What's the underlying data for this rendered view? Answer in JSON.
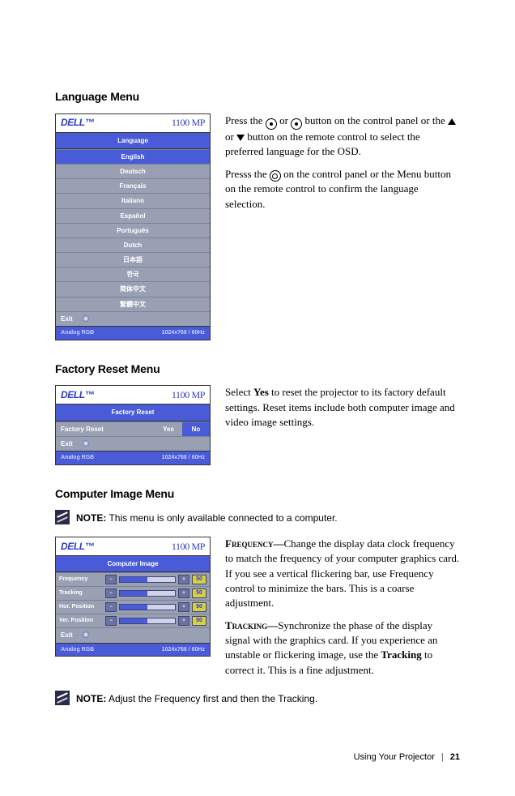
{
  "headings": {
    "language": "Language Menu",
    "factory": "Factory Reset Menu",
    "computer": "Computer Image Menu"
  },
  "osd": {
    "brand": "DELL™",
    "model": "1100 MP",
    "footer_left": "Analog RGB",
    "footer_right": "1024x768 / 60Hz",
    "exit": "Exit"
  },
  "language_menu": {
    "header": "Language",
    "items": [
      "English",
      "Deutsch",
      "Français",
      "Italiano",
      "Español",
      "Português",
      "Dutch",
      "日本語",
      "한국",
      "简体中文",
      "繁體中文"
    ]
  },
  "factory_menu": {
    "header": "Factory Reset",
    "label": "Factory Reset",
    "yes": "Yes",
    "no": "No"
  },
  "computer_menu": {
    "header": "Computer Image",
    "rows": [
      {
        "label": "Frequency",
        "val": "50"
      },
      {
        "label": "Tracking",
        "val": "50"
      },
      {
        "label": "Hor. Position",
        "val": "50"
      },
      {
        "label": "Ver. Position",
        "val": "50"
      }
    ]
  },
  "text": {
    "lang_p1a": "Press the ",
    "lang_p1b": " or ",
    "lang_p1c": " button on the control panel or the ",
    "lang_p1d": " or ",
    "lang_p1e": " button on the remote control to select the preferred language for the OSD.",
    "lang_p2a": "Presss the ",
    "lang_p2b": " on the control panel or the Menu button on the remote control to confirm the language selection.",
    "factory_p1a": "Select ",
    "factory_p1b": "Yes",
    "factory_p1c": " to reset the projector to its factory default settings. Reset items include both computer image and video image settings.",
    "freq_label": "Frequency—",
    "freq_body": "Change the display data clock frequency to match the frequency of your computer graphics card. If you see a vertical flickering bar, use Frequency control to minimize the bars. This is a coarse adjustment.",
    "track_label": "Tracking—",
    "track_body_a": "Synchronize the phase of the display signal with the graphics card. If you experience an unstable or flickering image, use the ",
    "track_body_b": "Tracking",
    "track_body_c": " to correct it. This is a fine adjustment."
  },
  "notes": {
    "prefix": "NOTE:",
    "note1": " This menu is only available connected to a computer.",
    "note2": " Adjust the Frequency first and then the Tracking."
  },
  "footer": {
    "section": "Using Your Projector",
    "page": "21"
  }
}
